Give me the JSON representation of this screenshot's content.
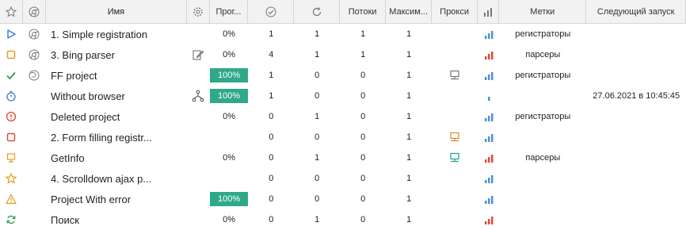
{
  "header": {
    "name": "Имя",
    "progress": "Прог...",
    "threads": "Потоки",
    "max": "Максим...",
    "proxy": "Прокси",
    "labels": "Метки",
    "next_run": "Следующий запуск"
  },
  "colors": {
    "progress_fill": "#2fa98a",
    "bar_blue": "#4a90d9",
    "bar_red": "#e04b3a",
    "proxy_orange": "#e0892a",
    "proxy_green": "#1ea58b",
    "proxy_gray": "#777777"
  },
  "rows": [
    {
      "status_icon": "play-icon",
      "browser_icon": "chrome-icon",
      "name": "1. Simple registration",
      "extra_icon": "",
      "progress": "0%",
      "progress_value": 0,
      "success": "1",
      "attempts": "1",
      "threads": "1",
      "max": "1",
      "proxy_icon": "",
      "stats_icon": "bar-chart-blue-icon",
      "labels": "регистраторы",
      "next_run": ""
    },
    {
      "status_icon": "stop-square-icon",
      "browser_icon": "chrome-icon",
      "name": "3. Bing parser",
      "extra_icon": "edit-icon",
      "progress": "0%",
      "progress_value": 0,
      "success": "4",
      "attempts": "1",
      "threads": "1",
      "max": "1",
      "proxy_icon": "",
      "stats_icon": "bar-chart-red-icon",
      "labels": "парсеры",
      "next_run": ""
    },
    {
      "status_icon": "check-icon",
      "browser_icon": "firefox-icon",
      "name": "FF project",
      "extra_icon": "",
      "progress": "100%",
      "progress_value": 100,
      "success": "1",
      "attempts": "0",
      "threads": "0",
      "max": "1",
      "proxy_icon": "proxy-gray-icon",
      "stats_icon": "bar-chart-blue-icon",
      "labels": "регистраторы",
      "next_run": ""
    },
    {
      "status_icon": "timer-icon",
      "browser_icon": "",
      "name": "Without browser",
      "extra_icon": "branch-icon",
      "progress": "100%",
      "progress_value": 100,
      "success": "1",
      "attempts": "0",
      "threads": "0",
      "max": "1",
      "proxy_icon": "",
      "stats_icon": "bar-chart-blue-small-icon",
      "labels": "",
      "next_run": "27.06.2021 в 10:45:45"
    },
    {
      "status_icon": "error-circle-icon",
      "browser_icon": "",
      "name": "Deleted project",
      "extra_icon": "",
      "progress": "0%",
      "progress_value": 0,
      "success": "0",
      "attempts": "1",
      "threads": "0",
      "max": "1",
      "proxy_icon": "",
      "stats_icon": "bar-chart-blue-icon",
      "labels": "регистраторы",
      "next_run": ""
    },
    {
      "status_icon": "stop-square-red-icon",
      "browser_icon": "",
      "name": "2. Form filling registr...",
      "extra_icon": "",
      "progress": "",
      "progress_value": null,
      "success": "0",
      "attempts": "0",
      "threads": "0",
      "max": "1",
      "proxy_icon": "proxy-orange-icon",
      "stats_icon": "bar-chart-blue-icon",
      "labels": "",
      "next_run": ""
    },
    {
      "status_icon": "computer-icon",
      "browser_icon": "",
      "name": "GetInfo",
      "extra_icon": "",
      "progress": "0%",
      "progress_value": 0,
      "success": "0",
      "attempts": "1",
      "threads": "0",
      "max": "1",
      "proxy_icon": "proxy-green-icon",
      "stats_icon": "bar-chart-red-icon",
      "labels": "парсеры",
      "next_run": ""
    },
    {
      "status_icon": "star-icon",
      "browser_icon": "",
      "name": "4. Scrolldown ajax p...",
      "extra_icon": "",
      "progress": "",
      "progress_value": null,
      "success": "0",
      "attempts": "0",
      "threads": "0",
      "max": "1",
      "proxy_icon": "",
      "stats_icon": "bar-chart-blue-icon",
      "labels": "",
      "next_run": ""
    },
    {
      "status_icon": "warning-icon",
      "browser_icon": "",
      "name": "Project With error",
      "extra_icon": "",
      "progress": "100%",
      "progress_value": 100,
      "success": "0",
      "attempts": "0",
      "threads": "0",
      "max": "1",
      "proxy_icon": "",
      "stats_icon": "bar-chart-blue-icon",
      "labels": "",
      "next_run": ""
    },
    {
      "status_icon": "refresh-icon",
      "browser_icon": "",
      "name": "Поиск",
      "extra_icon": "",
      "progress": "0%",
      "progress_value": 0,
      "success": "0",
      "attempts": "1",
      "threads": "0",
      "max": "1",
      "proxy_icon": "",
      "stats_icon": "bar-chart-red-icon",
      "labels": "",
      "next_run": ""
    }
  ]
}
